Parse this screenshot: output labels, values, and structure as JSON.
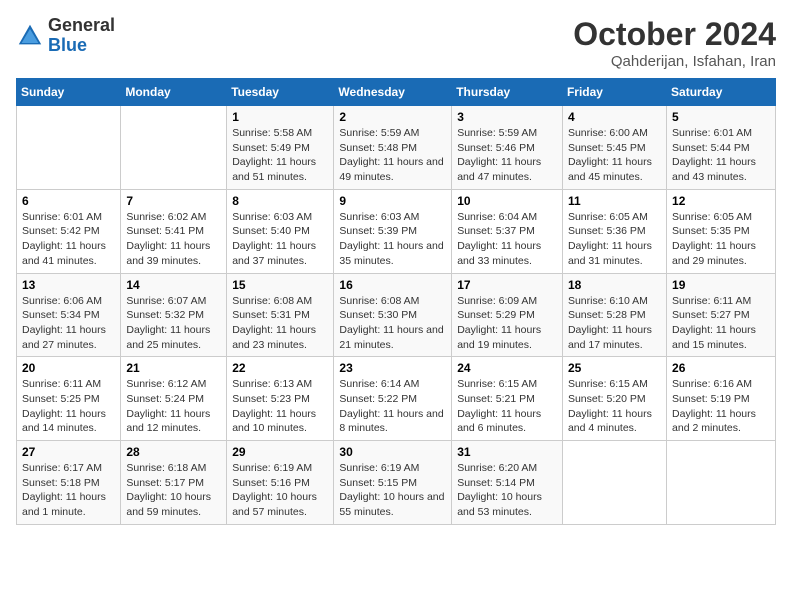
{
  "header": {
    "logo_general": "General",
    "logo_blue": "Blue",
    "title": "October 2024",
    "subtitle": "Qahderijan, Isfahan, Iran"
  },
  "columns": [
    "Sunday",
    "Monday",
    "Tuesday",
    "Wednesday",
    "Thursday",
    "Friday",
    "Saturday"
  ],
  "weeks": [
    [
      {
        "day": "",
        "info": ""
      },
      {
        "day": "",
        "info": ""
      },
      {
        "day": "1",
        "info": "Sunrise: 5:58 AM\nSunset: 5:49 PM\nDaylight: 11 hours and 51 minutes."
      },
      {
        "day": "2",
        "info": "Sunrise: 5:59 AM\nSunset: 5:48 PM\nDaylight: 11 hours and 49 minutes."
      },
      {
        "day": "3",
        "info": "Sunrise: 5:59 AM\nSunset: 5:46 PM\nDaylight: 11 hours and 47 minutes."
      },
      {
        "day": "4",
        "info": "Sunrise: 6:00 AM\nSunset: 5:45 PM\nDaylight: 11 hours and 45 minutes."
      },
      {
        "day": "5",
        "info": "Sunrise: 6:01 AM\nSunset: 5:44 PM\nDaylight: 11 hours and 43 minutes."
      }
    ],
    [
      {
        "day": "6",
        "info": "Sunrise: 6:01 AM\nSunset: 5:42 PM\nDaylight: 11 hours and 41 minutes."
      },
      {
        "day": "7",
        "info": "Sunrise: 6:02 AM\nSunset: 5:41 PM\nDaylight: 11 hours and 39 minutes."
      },
      {
        "day": "8",
        "info": "Sunrise: 6:03 AM\nSunset: 5:40 PM\nDaylight: 11 hours and 37 minutes."
      },
      {
        "day": "9",
        "info": "Sunrise: 6:03 AM\nSunset: 5:39 PM\nDaylight: 11 hours and 35 minutes."
      },
      {
        "day": "10",
        "info": "Sunrise: 6:04 AM\nSunset: 5:37 PM\nDaylight: 11 hours and 33 minutes."
      },
      {
        "day": "11",
        "info": "Sunrise: 6:05 AM\nSunset: 5:36 PM\nDaylight: 11 hours and 31 minutes."
      },
      {
        "day": "12",
        "info": "Sunrise: 6:05 AM\nSunset: 5:35 PM\nDaylight: 11 hours and 29 minutes."
      }
    ],
    [
      {
        "day": "13",
        "info": "Sunrise: 6:06 AM\nSunset: 5:34 PM\nDaylight: 11 hours and 27 minutes."
      },
      {
        "day": "14",
        "info": "Sunrise: 6:07 AM\nSunset: 5:32 PM\nDaylight: 11 hours and 25 minutes."
      },
      {
        "day": "15",
        "info": "Sunrise: 6:08 AM\nSunset: 5:31 PM\nDaylight: 11 hours and 23 minutes."
      },
      {
        "day": "16",
        "info": "Sunrise: 6:08 AM\nSunset: 5:30 PM\nDaylight: 11 hours and 21 minutes."
      },
      {
        "day": "17",
        "info": "Sunrise: 6:09 AM\nSunset: 5:29 PM\nDaylight: 11 hours and 19 minutes."
      },
      {
        "day": "18",
        "info": "Sunrise: 6:10 AM\nSunset: 5:28 PM\nDaylight: 11 hours and 17 minutes."
      },
      {
        "day": "19",
        "info": "Sunrise: 6:11 AM\nSunset: 5:27 PM\nDaylight: 11 hours and 15 minutes."
      }
    ],
    [
      {
        "day": "20",
        "info": "Sunrise: 6:11 AM\nSunset: 5:25 PM\nDaylight: 11 hours and 14 minutes."
      },
      {
        "day": "21",
        "info": "Sunrise: 6:12 AM\nSunset: 5:24 PM\nDaylight: 11 hours and 12 minutes."
      },
      {
        "day": "22",
        "info": "Sunrise: 6:13 AM\nSunset: 5:23 PM\nDaylight: 11 hours and 10 minutes."
      },
      {
        "day": "23",
        "info": "Sunrise: 6:14 AM\nSunset: 5:22 PM\nDaylight: 11 hours and 8 minutes."
      },
      {
        "day": "24",
        "info": "Sunrise: 6:15 AM\nSunset: 5:21 PM\nDaylight: 11 hours and 6 minutes."
      },
      {
        "day": "25",
        "info": "Sunrise: 6:15 AM\nSunset: 5:20 PM\nDaylight: 11 hours and 4 minutes."
      },
      {
        "day": "26",
        "info": "Sunrise: 6:16 AM\nSunset: 5:19 PM\nDaylight: 11 hours and 2 minutes."
      }
    ],
    [
      {
        "day": "27",
        "info": "Sunrise: 6:17 AM\nSunset: 5:18 PM\nDaylight: 11 hours and 1 minute."
      },
      {
        "day": "28",
        "info": "Sunrise: 6:18 AM\nSunset: 5:17 PM\nDaylight: 10 hours and 59 minutes."
      },
      {
        "day": "29",
        "info": "Sunrise: 6:19 AM\nSunset: 5:16 PM\nDaylight: 10 hours and 57 minutes."
      },
      {
        "day": "30",
        "info": "Sunrise: 6:19 AM\nSunset: 5:15 PM\nDaylight: 10 hours and 55 minutes."
      },
      {
        "day": "31",
        "info": "Sunrise: 6:20 AM\nSunset: 5:14 PM\nDaylight: 10 hours and 53 minutes."
      },
      {
        "day": "",
        "info": ""
      },
      {
        "day": "",
        "info": ""
      }
    ]
  ]
}
